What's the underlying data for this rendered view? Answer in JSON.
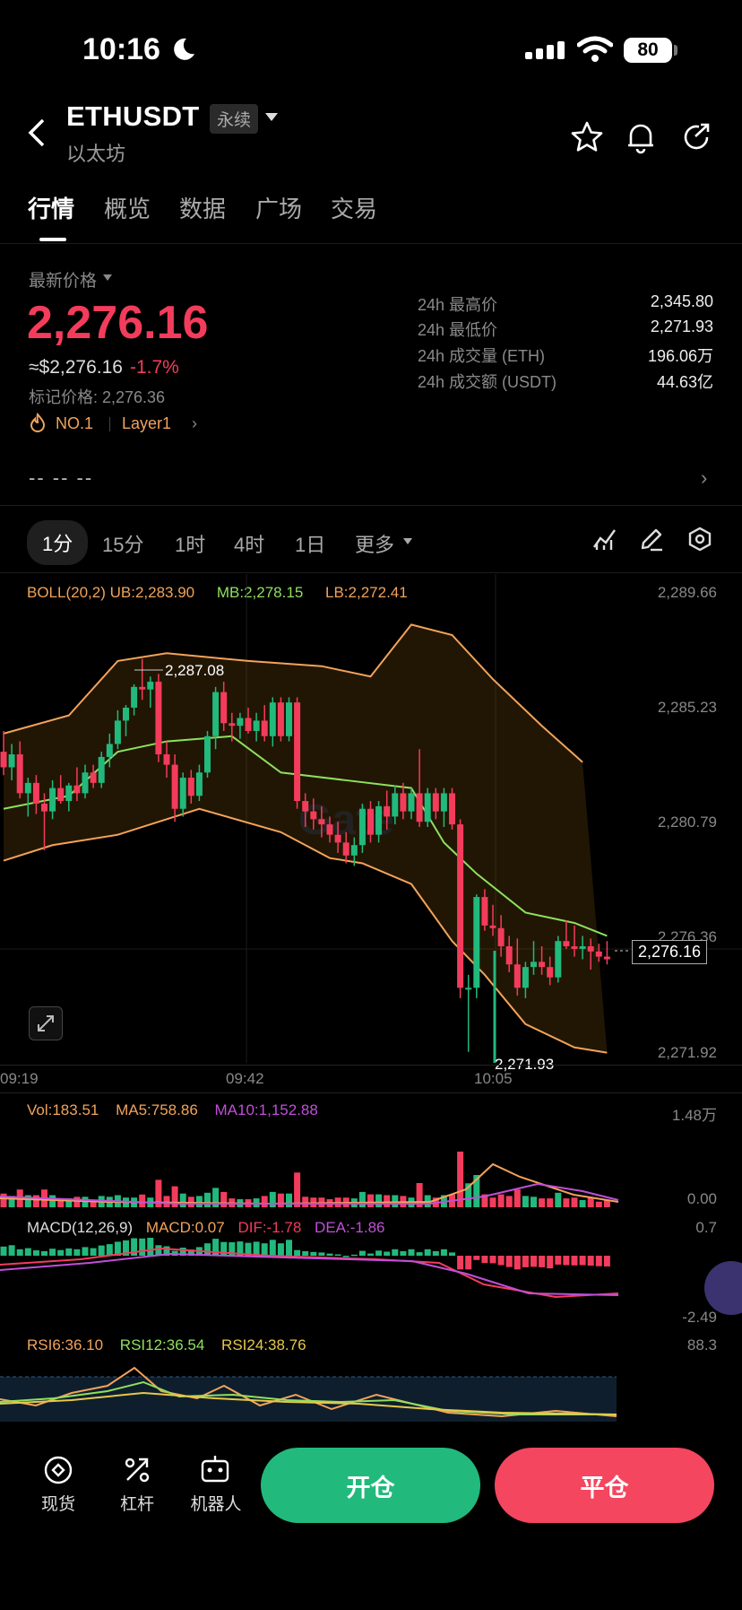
{
  "status_bar": {
    "time": "10:16",
    "battery": "80"
  },
  "header": {
    "symbol": "ETHUSDT",
    "badge": "永续",
    "subname": "以太坊"
  },
  "tabs": [
    "行情",
    "概览",
    "数据",
    "广场",
    "交易"
  ],
  "price": {
    "latest_label": "最新价格",
    "last": "2,276.16",
    "approx": "≈$2,276.16",
    "change": "-1.7%",
    "mark": "标记价格: 2,276.36",
    "rank": "NO.1",
    "tag": "Layer1",
    "dashes": "--  -- --"
  },
  "stats": [
    {
      "k": "24h 最高价",
      "v": "2,345.80"
    },
    {
      "k": "24h 最低价",
      "v": "2,271.93"
    },
    {
      "k": "24h 成交量 (ETH)",
      "v": "196.06万"
    },
    {
      "k": "24h 成交额 (USDT)",
      "v": "44.63亿"
    }
  ],
  "timeframes": {
    "selected": "1分",
    "others": [
      "15分",
      "1时",
      "4时",
      "1日"
    ],
    "more": "更多"
  },
  "boll": {
    "label": "BOLL(20,2)",
    "ub": "UB:2,283.90",
    "mb": "MB:2,278.15",
    "lb": "LB:2,272.41"
  },
  "price_axis": [
    "2,289.66",
    "2,285.23",
    "2,280.79",
    "2,276.36",
    "2,271.92"
  ],
  "current_price_tag": "2,276.16",
  "high_marker": "2,287.08",
  "low_marker": "2,271.93",
  "time_axis": [
    "09:19",
    "09:42",
    "10:05"
  ],
  "watermark": "Gate",
  "volume": {
    "vol": "Vol:183.51",
    "ma5": "MA5:758.86",
    "ma10": "MA10:1,152.88",
    "axis_top": "1.48万",
    "axis_bottom": "0.00"
  },
  "macd": {
    "label": "MACD(12,26,9)",
    "macd": "MACD:0.07",
    "dif": "DIF:-1.78",
    "dea": "DEA:-1.86",
    "axis_top": "0.7",
    "axis_bottom": "-2.49"
  },
  "rsi": {
    "rsi6": "RSI6:36.10",
    "rsi12": "RSI12:36.54",
    "rsi24": "RSI24:38.76",
    "axis_top": "88.3"
  },
  "bottom": {
    "spot": "现货",
    "leverage": "杠杆",
    "bot": "机器人",
    "open": "开仓",
    "close": "平仓"
  },
  "colors": {
    "up": "#22b97d",
    "down": "#f33c5c",
    "accent": "#f2a35a"
  },
  "chart_data": {
    "type": "candlestick",
    "price_range": [
      2271.92,
      2289.66
    ],
    "candles": [
      {
        "o": 2283.5,
        "h": 2284.3,
        "l": 2282.6,
        "c": 2282.9
      },
      {
        "o": 2282.9,
        "h": 2283.8,
        "l": 2282.4,
        "c": 2283.4
      },
      {
        "o": 2283.4,
        "h": 2283.9,
        "l": 2281.7,
        "c": 2281.9
      },
      {
        "o": 2281.9,
        "h": 2282.5,
        "l": 2281.0,
        "c": 2282.3
      },
      {
        "o": 2282.3,
        "h": 2282.6,
        "l": 2281.1,
        "c": 2281.5
      },
      {
        "o": 2281.5,
        "h": 2281.9,
        "l": 2279.7,
        "c": 2281.2
      },
      {
        "o": 2281.2,
        "h": 2282.4,
        "l": 2280.9,
        "c": 2282.1
      },
      {
        "o": 2282.1,
        "h": 2282.6,
        "l": 2281.5,
        "c": 2281.6
      },
      {
        "o": 2281.6,
        "h": 2282.3,
        "l": 2281.2,
        "c": 2282.2
      },
      {
        "o": 2282.2,
        "h": 2282.9,
        "l": 2281.6,
        "c": 2281.9
      },
      {
        "o": 2281.9,
        "h": 2283.0,
        "l": 2281.7,
        "c": 2282.7
      },
      {
        "o": 2282.7,
        "h": 2283.0,
        "l": 2282.1,
        "c": 2282.3
      },
      {
        "o": 2282.3,
        "h": 2283.5,
        "l": 2282.1,
        "c": 2283.3
      },
      {
        "o": 2283.3,
        "h": 2284.2,
        "l": 2282.9,
        "c": 2283.8
      },
      {
        "o": 2283.8,
        "h": 2285.1,
        "l": 2283.6,
        "c": 2284.7
      },
      {
        "o": 2284.7,
        "h": 2285.3,
        "l": 2284.1,
        "c": 2285.2
      },
      {
        "o": 2285.2,
        "h": 2286.1,
        "l": 2284.9,
        "c": 2286.0
      },
      {
        "o": 2286.0,
        "h": 2287.08,
        "l": 2285.5,
        "c": 2285.9
      },
      {
        "o": 2285.9,
        "h": 2286.4,
        "l": 2285.2,
        "c": 2286.2
      },
      {
        "o": 2286.2,
        "h": 2286.5,
        "l": 2283.1,
        "c": 2283.4
      },
      {
        "o": 2283.4,
        "h": 2283.9,
        "l": 2282.5,
        "c": 2283.0
      },
      {
        "o": 2283.0,
        "h": 2283.4,
        "l": 2280.8,
        "c": 2281.3
      },
      {
        "o": 2281.3,
        "h": 2282.7,
        "l": 2281.0,
        "c": 2282.5
      },
      {
        "o": 2282.5,
        "h": 2282.8,
        "l": 2281.5,
        "c": 2281.8
      },
      {
        "o": 2281.8,
        "h": 2283.0,
        "l": 2281.6,
        "c": 2282.7
      },
      {
        "o": 2282.7,
        "h": 2284.3,
        "l": 2282.5,
        "c": 2284.1
      },
      {
        "o": 2284.1,
        "h": 2286.0,
        "l": 2283.6,
        "c": 2285.8
      },
      {
        "o": 2285.8,
        "h": 2286.2,
        "l": 2284.3,
        "c": 2284.6
      },
      {
        "o": 2284.6,
        "h": 2285.0,
        "l": 2283.9,
        "c": 2284.5
      },
      {
        "o": 2284.5,
        "h": 2285.0,
        "l": 2284.0,
        "c": 2284.8
      },
      {
        "o": 2284.8,
        "h": 2285.2,
        "l": 2284.2,
        "c": 2284.3
      },
      {
        "o": 2284.3,
        "h": 2285.0,
        "l": 2283.9,
        "c": 2284.7
      },
      {
        "o": 2284.7,
        "h": 2285.3,
        "l": 2283.9,
        "c": 2284.1
      },
      {
        "o": 2284.1,
        "h": 2285.6,
        "l": 2283.7,
        "c": 2285.4
      },
      {
        "o": 2285.4,
        "h": 2285.6,
        "l": 2283.9,
        "c": 2284.1
      },
      {
        "o": 2284.1,
        "h": 2285.6,
        "l": 2283.9,
        "c": 2285.4
      },
      {
        "o": 2285.4,
        "h": 2285.6,
        "l": 2281.3,
        "c": 2281.6
      },
      {
        "o": 2281.6,
        "h": 2281.9,
        "l": 2280.6,
        "c": 2281.2
      },
      {
        "o": 2281.2,
        "h": 2281.7,
        "l": 2280.5,
        "c": 2280.9
      },
      {
        "o": 2280.9,
        "h": 2281.4,
        "l": 2280.2,
        "c": 2280.7
      },
      {
        "o": 2280.7,
        "h": 2281.0,
        "l": 2280.0,
        "c": 2280.3
      },
      {
        "o": 2280.3,
        "h": 2280.8,
        "l": 2279.6,
        "c": 2280.0
      },
      {
        "o": 2280.0,
        "h": 2280.4,
        "l": 2279.2,
        "c": 2279.5
      },
      {
        "o": 2279.5,
        "h": 2280.2,
        "l": 2279.1,
        "c": 2279.9
      },
      {
        "o": 2279.9,
        "h": 2281.5,
        "l": 2279.6,
        "c": 2281.3
      },
      {
        "o": 2281.3,
        "h": 2281.6,
        "l": 2280.0,
        "c": 2280.3
      },
      {
        "o": 2280.3,
        "h": 2281.6,
        "l": 2280.0,
        "c": 2281.4
      },
      {
        "o": 2281.4,
        "h": 2282.0,
        "l": 2280.5,
        "c": 2281.0
      },
      {
        "o": 2281.0,
        "h": 2282.2,
        "l": 2280.7,
        "c": 2281.9
      },
      {
        "o": 2281.9,
        "h": 2282.3,
        "l": 2280.9,
        "c": 2281.2
      },
      {
        "o": 2281.2,
        "h": 2282.1,
        "l": 2280.9,
        "c": 2281.9
      },
      {
        "o": 2281.9,
        "h": 2283.6,
        "l": 2280.6,
        "c": 2280.8
      },
      {
        "o": 2280.8,
        "h": 2282.1,
        "l": 2280.6,
        "c": 2281.9
      },
      {
        "o": 2281.9,
        "h": 2282.1,
        "l": 2280.9,
        "c": 2281.2
      },
      {
        "o": 2281.2,
        "h": 2282.1,
        "l": 2280.6,
        "c": 2281.9
      },
      {
        "o": 2281.9,
        "h": 2282.1,
        "l": 2280.5,
        "c": 2280.7
      },
      {
        "o": 2280.7,
        "h": 2280.9,
        "l": 2274.0,
        "c": 2274.4
      },
      {
        "o": 2274.4,
        "h": 2274.9,
        "l": 2271.93,
        "c": 2274.4
      },
      {
        "o": 2274.4,
        "h": 2278.0,
        "l": 2274.0,
        "c": 2277.9
      },
      {
        "o": 2277.9,
        "h": 2278.2,
        "l": 2276.6,
        "c": 2276.8
      },
      {
        "o": 2276.8,
        "h": 2277.6,
        "l": 2276.4,
        "c": 2276.7
      },
      {
        "o": 2276.7,
        "h": 2277.2,
        "l": 2275.6,
        "c": 2276.0
      },
      {
        "o": 2276.0,
        "h": 2276.4,
        "l": 2275.0,
        "c": 2275.3
      },
      {
        "o": 2275.3,
        "h": 2276.3,
        "l": 2274.1,
        "c": 2274.4
      },
      {
        "o": 2274.4,
        "h": 2275.4,
        "l": 2274.0,
        "c": 2275.2
      },
      {
        "o": 2275.2,
        "h": 2276.2,
        "l": 2274.9,
        "c": 2275.4
      },
      {
        "o": 2275.4,
        "h": 2276.0,
        "l": 2274.9,
        "c": 2275.2
      },
      {
        "o": 2275.2,
        "h": 2275.6,
        "l": 2274.5,
        "c": 2274.8
      },
      {
        "o": 2274.8,
        "h": 2276.4,
        "l": 2274.6,
        "c": 2276.2
      },
      {
        "o": 2276.2,
        "h": 2277.0,
        "l": 2275.9,
        "c": 2276.0
      },
      {
        "o": 2276.0,
        "h": 2276.8,
        "l": 2275.6,
        "c": 2275.9
      },
      {
        "o": 2275.9,
        "h": 2276.4,
        "l": 2275.5,
        "c": 2276.0
      },
      {
        "o": 2276.0,
        "h": 2276.3,
        "l": 2275.1,
        "c": 2275.8
      },
      {
        "o": 2275.8,
        "h": 2276.1,
        "l": 2275.4,
        "c": 2275.6
      },
      {
        "o": 2275.6,
        "h": 2276.2,
        "l": 2275.3,
        "c": 2275.5
      }
    ],
    "boll": {
      "ub_points": [
        [
          0,
          2284.2
        ],
        [
          8,
          2284.9
        ],
        [
          14,
          2287.0
        ],
        [
          20,
          2287.3
        ],
        [
          30,
          2287.0
        ],
        [
          39,
          2286.8
        ],
        [
          45,
          2286.4
        ],
        [
          50,
          2288.4
        ],
        [
          55,
          2288.0
        ],
        [
          60,
          2286.3
        ],
        [
          66,
          2284.5
        ],
        [
          71,
          2283.1
        ]
      ],
      "mb_points": [
        [
          0,
          2281.3
        ],
        [
          8,
          2281.8
        ],
        [
          14,
          2283.5
        ],
        [
          20,
          2283.9
        ],
        [
          28,
          2284.1
        ],
        [
          34,
          2282.7
        ],
        [
          42,
          2282.4
        ],
        [
          50,
          2282.1
        ],
        [
          54,
          2280.0
        ],
        [
          58,
          2278.8
        ],
        [
          64,
          2277.3
        ],
        [
          70,
          2276.9
        ],
        [
          74,
          2276.4
        ]
      ],
      "lb_points": [
        [
          0,
          2279.3
        ],
        [
          6,
          2279.9
        ],
        [
          14,
          2280.3
        ],
        [
          24,
          2281.3
        ],
        [
          34,
          2280.4
        ],
        [
          40,
          2279.4
        ],
        [
          44,
          2279.2
        ],
        [
          50,
          2278.4
        ],
        [
          55,
          2276.2
        ],
        [
          59,
          2274.9
        ],
        [
          64,
          2273.0
        ],
        [
          70,
          2272.1
        ],
        [
          74,
          2271.9
        ]
      ]
    }
  }
}
